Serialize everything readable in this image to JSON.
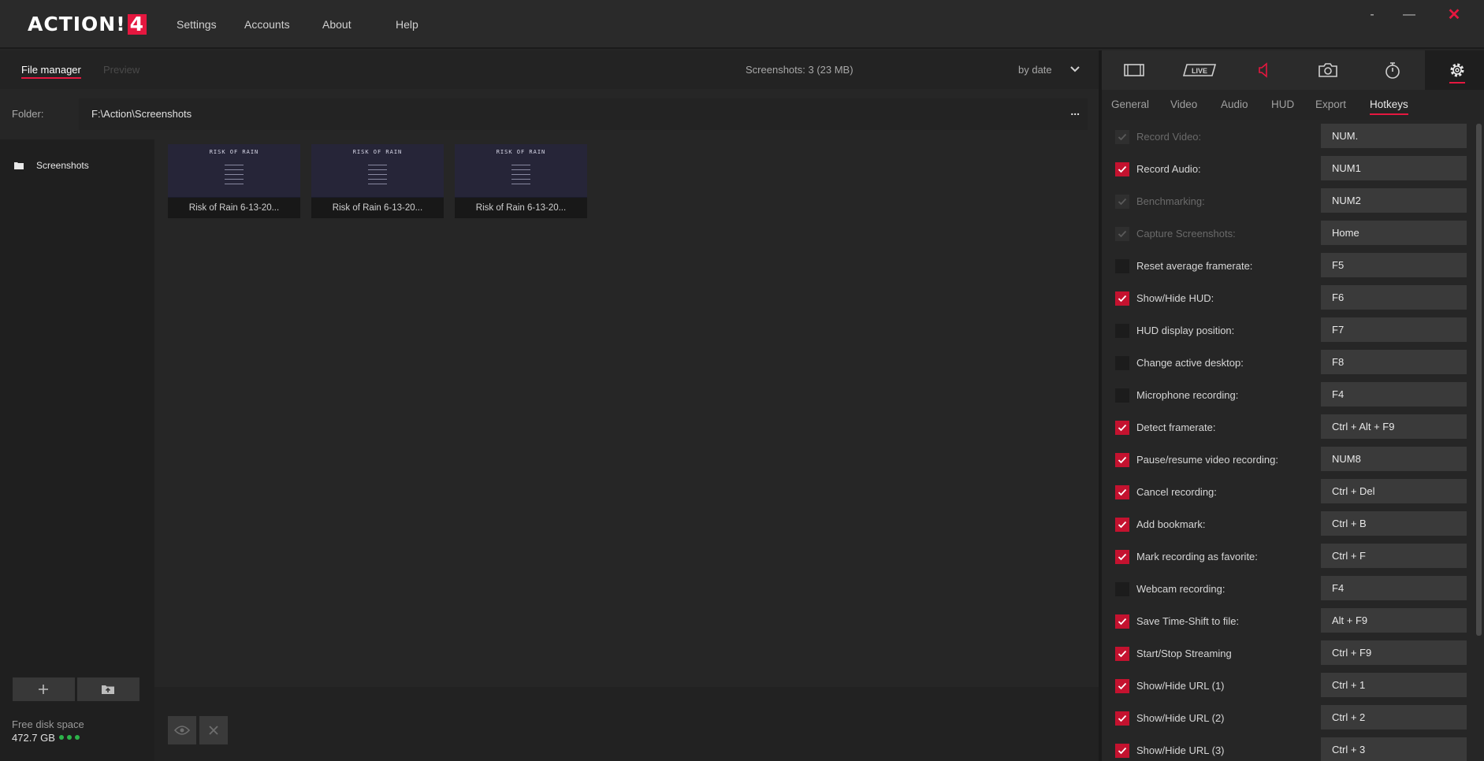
{
  "app": {
    "logo_text": "ACTION!",
    "logo_version": "4",
    "menu": [
      "Settings",
      "Accounts",
      "About",
      "Help"
    ],
    "window_buttons": {
      "minimize": "-",
      "maximize": "—",
      "close": "✕"
    }
  },
  "file_manager": {
    "tabs": [
      "File manager",
      "Preview"
    ],
    "count_label": "Screenshots: 3 (23 MB)",
    "sort_label": "by date",
    "folder_label": "Folder:",
    "folder_path": "F:\\Action\\Screenshots",
    "folder_more": "...",
    "sidebar": {
      "items": [
        {
          "label": "Screenshots",
          "icon": "folder-icon"
        }
      ],
      "free_space_label": "Free disk space",
      "free_space_value": "472.7 GB"
    },
    "thumbnails": [
      {
        "caption": "Risk of Rain 6-13-20...",
        "image_title": "RISK OF RAIN"
      },
      {
        "caption": "Risk of Rain 6-13-20...",
        "image_title": "RISK OF RAIN"
      },
      {
        "caption": "Risk of Rain 6-13-20...",
        "image_title": "RISK OF RAIN"
      }
    ]
  },
  "settings_panel": {
    "icon_tabs": [
      "film-icon",
      "live-icon",
      "audio-icon",
      "camera-icon",
      "stopwatch-icon",
      "gear-icon"
    ],
    "live_label": "LIVE",
    "sub_tabs": [
      "General",
      "Video",
      "Audio",
      "HUD",
      "Export",
      "Hotkeys"
    ],
    "active_sub_tab": "Hotkeys",
    "hotkeys": [
      {
        "label": "Record Video:",
        "key": "NUM.",
        "state": "disabled"
      },
      {
        "label": "Record Audio:",
        "key": "NUM1",
        "state": "checked"
      },
      {
        "label": "Benchmarking:",
        "key": "NUM2",
        "state": "disabled"
      },
      {
        "label": "Capture Screenshots:",
        "key": "Home",
        "state": "disabled"
      },
      {
        "label": "Reset average framerate:",
        "key": "F5",
        "state": "unchecked"
      },
      {
        "label": "Show/Hide HUD:",
        "key": "F6",
        "state": "checked"
      },
      {
        "label": "HUD display position:",
        "key": "F7",
        "state": "unchecked"
      },
      {
        "label": "Change active desktop:",
        "key": "F8",
        "state": "unchecked"
      },
      {
        "label": "Microphone recording:",
        "key": "F4",
        "state": "unchecked"
      },
      {
        "label": "Detect framerate:",
        "key": "Ctrl + Alt + F9",
        "state": "checked"
      },
      {
        "label": "Pause/resume video recording:",
        "key": "NUM8",
        "state": "checked"
      },
      {
        "label": "Cancel recording:",
        "key": "Ctrl + Del",
        "state": "checked"
      },
      {
        "label": "Add bookmark:",
        "key": "Ctrl + B",
        "state": "checked"
      },
      {
        "label": "Mark recording as favorite:",
        "key": "Ctrl + F",
        "state": "checked"
      },
      {
        "label": "Webcam recording:",
        "key": "F4",
        "state": "unchecked"
      },
      {
        "label": "Save Time-Shift to file:",
        "key": "Alt + F9",
        "state": "checked"
      },
      {
        "label": "Start/Stop Streaming",
        "key": "Ctrl + F9",
        "state": "checked"
      },
      {
        "label": "Show/Hide URL (1)",
        "key": "Ctrl + 1",
        "state": "checked"
      },
      {
        "label": "Show/Hide URL (2)",
        "key": "Ctrl + 2",
        "state": "checked"
      },
      {
        "label": "Show/Hide URL (3)",
        "key": "Ctrl + 3",
        "state": "checked"
      }
    ]
  },
  "colors": {
    "accent": "#e5173f",
    "checkbox_on": "#c4122f",
    "status_dot": "#2db34a"
  }
}
